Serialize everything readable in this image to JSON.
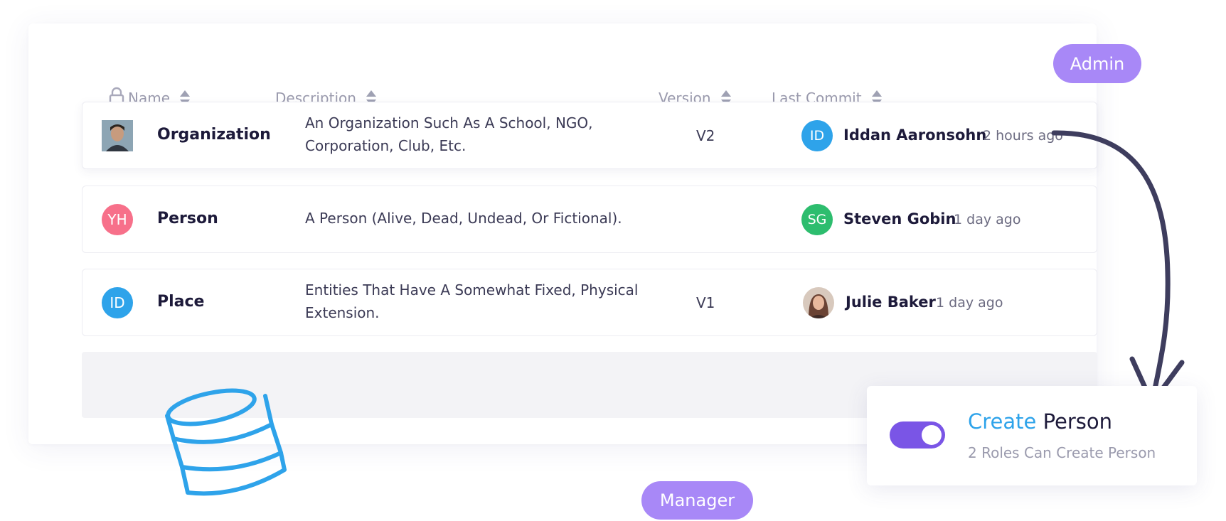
{
  "table": {
    "headers": {
      "name": "Name",
      "description": "Description",
      "version": "Version",
      "last_commit": "Last Commit"
    },
    "rows": [
      {
        "avatar": "",
        "avatar_type": "photo",
        "name": "Organization",
        "description": "An Organization Such As A School, NGO, Corporation, Club, Etc.",
        "version": "V2",
        "committer_initials": "ID",
        "committer_color": "#2ea3ea",
        "committer": "Iddan Aaronsohn",
        "time": "2 hours ago"
      },
      {
        "avatar": "YH",
        "avatar_color": "#f7708a",
        "name": "Person",
        "description": "A Person (Alive, Dead, Undead, Or Fictional).",
        "version": "",
        "committer_initials": "SG",
        "committer_color": "#2dbd6e",
        "committer": "Steven Gobin",
        "time": "1 day ago"
      },
      {
        "avatar": "ID",
        "avatar_color": "#2ea3ea",
        "name": "Place",
        "description": "Entities That Have A Somewhat Fixed, Physical Extension.",
        "version": "V1",
        "committer_initials": "",
        "committer_avatar_type": "photo",
        "committer": "Julie Baker",
        "time": "1 day ago"
      }
    ]
  },
  "badges": {
    "admin": "Admin",
    "manager": "Manager"
  },
  "permission_card": {
    "title_accent": "Create",
    "title_rest": " Person",
    "subtitle": "2 Roles Can Create Person",
    "toggle_on": true
  },
  "colors": {
    "accent_blue": "#2ea3ea",
    "purple": "#a888f7",
    "toggle": "#7a55e6",
    "arrow": "#3e3d5e"
  },
  "icons": [
    "lock-icon",
    "sort-icon",
    "database-icon",
    "curved-arrow-icon"
  ]
}
